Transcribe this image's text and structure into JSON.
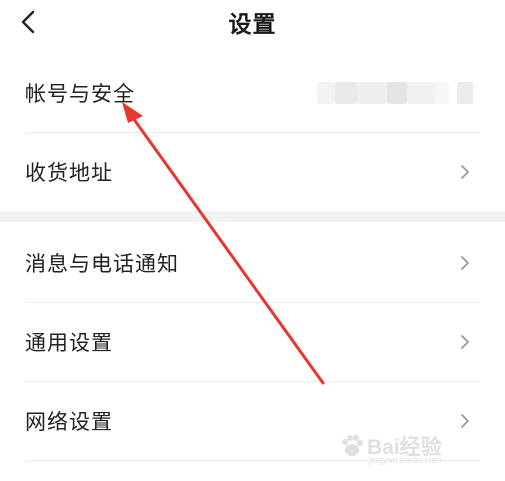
{
  "header": {
    "title": "设置",
    "back_icon": "chevron-left-icon"
  },
  "settings": {
    "account_security": {
      "label": "帐号与安全",
      "value_masked": true
    },
    "shipping_address": {
      "label": "收货地址",
      "chevron_icon": "chevron-right-icon"
    },
    "notifications": {
      "label": "消息与电话通知",
      "chevron_icon": "chevron-right-icon"
    },
    "general": {
      "label": "通用设置",
      "chevron_icon": "chevron-right-icon"
    },
    "network": {
      "label": "网络设置",
      "chevron_icon": "chevron-right-icon"
    }
  },
  "annotation": {
    "type": "arrow",
    "color": "#e8362f"
  },
  "watermark": {
    "text": "Bai经验",
    "subtext": "jingyan.baidu.com"
  },
  "colors": {
    "text": "#222222",
    "divider": "#eeeeee",
    "section_gap": "#f2f2f2",
    "chevron": "#9a9a9a"
  }
}
